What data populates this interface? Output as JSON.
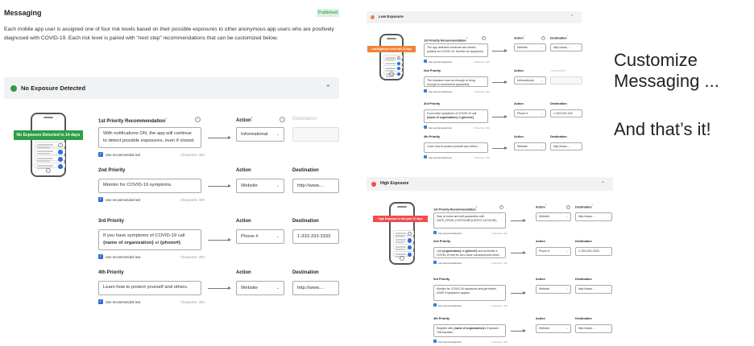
{
  "messaging": {
    "title": "Messaging",
    "status": "Published",
    "description": "Each mobile app user is assigned one of four risk levels based on their possible exposures to other anonymous app users who are positively diagnosed with COVID-19. Each risk level is paired with “next step” recommendations that can be customized below."
  },
  "colors": {
    "green": "#2e9d46",
    "orange": "#f0833a",
    "red": "#ee4d4d",
    "blue": "#2d6cdf",
    "section_bg": "#f1f2f4"
  },
  "icons": {
    "collapse": "chevron-up-icon",
    "help": "question-circle-icon",
    "check": "checkbox-checked-icon",
    "arrow": "arrow-right-icon",
    "dropdown": "chevron-down-icon"
  },
  "panels": [
    {
      "title": "No Exposure Detected",
      "color": "#2e9d46",
      "banner": "No Exposure Detected in 14 days",
      "rows": [
        {
          "label": "1st Priority Recommendation",
          "label_mark": "*",
          "text": "With notifications ON, the app will continue to detect possible exposures, even if closed.",
          "checkbox": "Use recommended text",
          "chars": "Characters: 300",
          "action_label": "Action",
          "action_mark": "*",
          "action": "Informational",
          "dest_label": "Destination",
          "dest": "",
          "dest_disabled": true
        },
        {
          "label": "2nd Priority",
          "text": "Monitor for COVID-19 symptoms.",
          "checkbox": "Use recommended text",
          "chars": "Characters: 300",
          "action_label": "Action",
          "action": "Website",
          "dest_label": "Destination",
          "dest": "http://www...."
        },
        {
          "label": "3rd Priority",
          "text_parts": [
            {
              "t": "If you have symptoms of COVID-19 call "
            },
            {
              "t": "{name of organization}",
              "b": true
            },
            {
              "t": " at "
            },
            {
              "t": "{phone#}",
              "b": true
            },
            {
              "t": "."
            }
          ],
          "checkbox": "Use recommended text",
          "chars": "Characters: 300",
          "action_label": "Action",
          "action": "Phone #",
          "dest_label": "Destination",
          "dest": "1-333-333-3333"
        },
        {
          "label": "4th Priority",
          "text": "Learn how to protect yourself and others.",
          "checkbox": "Use recommended text",
          "chars": "Characters: 300",
          "action_label": "Action",
          "action": "Website",
          "dest_label": "Destination",
          "dest": "http://www...."
        }
      ]
    },
    {
      "title": "Low Exposure",
      "color": "#f0833a",
      "banner": "Low Exposure in the last 14 days",
      "rows": [
        {
          "label": "1st Priority Recommendation",
          "label_mark": "*",
          "text": "The app detected someone who tested positive for COVID-19. Monitor for symptoms.",
          "checkbox": "Use recommended text",
          "chars": "Characters: 300",
          "action_label": "Action",
          "action_mark": "*",
          "action": "Website",
          "dest_label": "Destination",
          "dest_mark": "*",
          "dest": "http://www...."
        },
        {
          "label": "2nd Priority",
          "text": "The exposure was not enough to bring enough to recommend quarantine.",
          "checkbox": "Use recommended text",
          "chars": "Characters: 300",
          "action_label": "Action",
          "action": "Informational",
          "dest_label": "Destination",
          "dest": "",
          "dest_disabled": true
        },
        {
          "label": "3rd Priority",
          "text_parts": [
            {
              "t": "If you have symptoms of COVID-19 call "
            },
            {
              "t": "{name of organization}",
              "b": true
            },
            {
              "t": " at "
            },
            {
              "t": "{phone#}",
              "b": true
            },
            {
              "t": "."
            }
          ],
          "checkbox": "Use recommended text",
          "chars": "Characters: 300",
          "action_label": "Action",
          "action": "Phone #",
          "dest_label": "Destination",
          "dest": "1-333-333-333"
        },
        {
          "label": "4th Priority",
          "text": "Learn how to protect yourself and others.",
          "checkbox": "Use recommended text",
          "chars": "Characters: 300",
          "action_label": "Action",
          "action": "Website",
          "dest_label": "Destination",
          "dest": "http://www...."
        }
      ]
    },
    {
      "title": "High Exposure",
      "color": "#ee4d4d",
      "banner": "High Exposure in the past 14 days",
      "rows": [
        {
          "label": "1st Priority Recommendation",
          "label_mark": "*",
          "text": "Stay at home and self-quarantine until DATE_FROM_EXPOSURE(LATEST,14,FALSE).",
          "checkbox": "Use recommended text",
          "chars": "Characters: 300",
          "action_label": "Action",
          "action_mark": "*",
          "action": "Website",
          "dest_label": "Destination",
          "dest_mark": "*",
          "dest": "http://www...."
        },
        {
          "label": "2nd Priority",
          "text_parts": [
            {
              "t": "Call "
            },
            {
              "t": "{organization}",
              "b": true
            },
            {
              "t": " at "
            },
            {
              "t": "{phone#}",
              "b": true
            },
            {
              "t": " and schedule a COVID-19 test for zero close consequences times."
            }
          ],
          "checkbox": "Use recommended text",
          "chars": "Characters: 300",
          "action_label": "Action",
          "action": "Phone #",
          "dest_label": "Destination",
          "dest": "1-333-333-3333"
        },
        {
          "label": "3rd Priority",
          "text": "Monitor for COVID-19 symptoms and get tested ASAP if symptoms appear.",
          "checkbox": "Use recommended text",
          "chars": "Characters: 300",
          "action_label": "Action",
          "action": "Website",
          "dest_label": "Destination",
          "dest": "http://www...."
        },
        {
          "label": "4th Priority",
          "text_parts": [
            {
              "t": "Register with "
            },
            {
              "t": "{name of organization}",
              "b": true
            },
            {
              "t": "'s Exposure Tracing team."
            }
          ],
          "checkbox": "Use recommended text",
          "chars": "Characters: 300",
          "action_label": "Action",
          "action": "Website",
          "dest_label": "Destination",
          "dest": "http://www...."
        }
      ]
    }
  ],
  "side_text": {
    "line1": "Customize",
    "line2": "Messaging ...",
    "line3": "And that’s it!"
  }
}
